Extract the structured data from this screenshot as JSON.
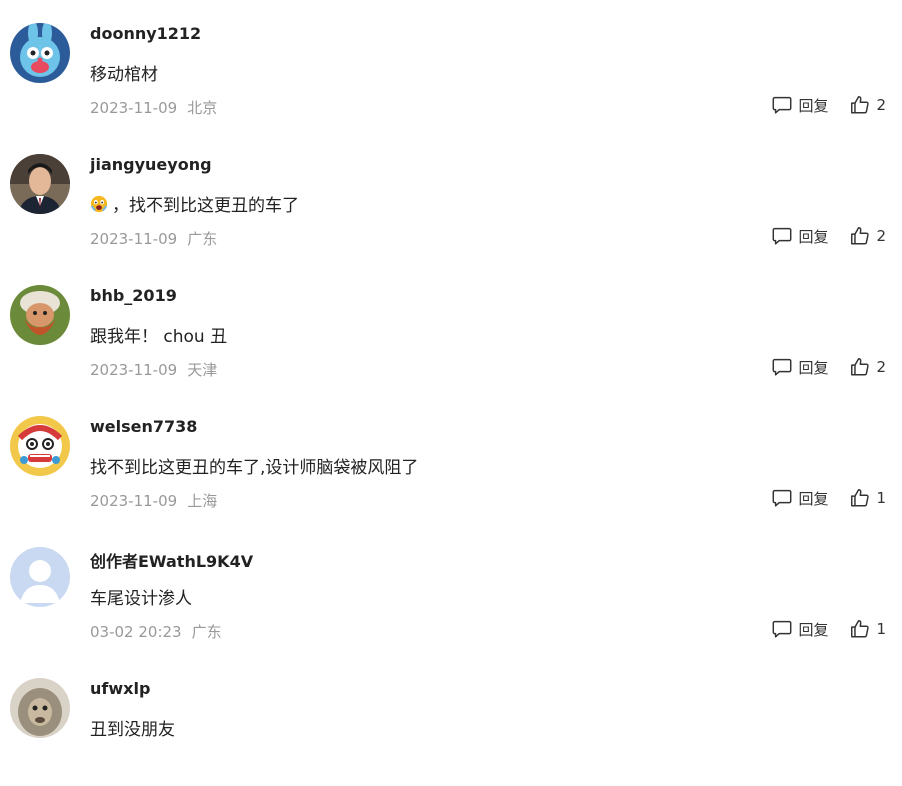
{
  "comments": [
    {
      "user": "doonny1212",
      "text": "移动棺材",
      "emoji": "",
      "time": "2023-11-09",
      "location": "北京",
      "reply_label": "回复",
      "likes": "2",
      "avatar_icon": "blue-rabbit-avatar",
      "avatar_color": "#2c5b9a"
    },
    {
      "user": "jiangyueyong",
      "text": "，找不到比这更丑的车了",
      "emoji": "scared-face-emoji",
      "time": "2023-11-09",
      "location": "广东",
      "reply_label": "回复",
      "likes": "2",
      "avatar_icon": "man-in-suit-avatar",
      "avatar_color": "#4a4038"
    },
    {
      "user": "bhb_2019",
      "text": "跟我年！ chou 丑",
      "emoji": "",
      "time": "2023-11-09",
      "location": "天津",
      "reply_label": "回复",
      "likes": "2",
      "avatar_icon": "bearded-dwarf-avatar",
      "avatar_color": "#6b8a3a"
    },
    {
      "user": "welsen7738",
      "text": "找不到比这更丑的车了,设计师脑袋被风阻了",
      "emoji": "",
      "time": "2023-11-09",
      "location": "上海",
      "reply_label": "回复",
      "likes": "1",
      "avatar_icon": "lion-dance-avatar",
      "avatar_color": "#f2c84b"
    },
    {
      "user": "创作者EWathL9K4V",
      "text": "车尾设计渗人",
      "emoji": "",
      "time": "03-02 20:23",
      "location": "广东",
      "reply_label": "回复",
      "likes": "1",
      "avatar_icon": "default-user-avatar",
      "avatar_color": "#c9d9f2"
    },
    {
      "user": "ufwxlp",
      "text": "丑到没朋友",
      "emoji": "",
      "time": "",
      "location": "",
      "reply_label": "",
      "likes": "",
      "avatar_icon": "monkey-avatar",
      "avatar_color": "#9a8e7c"
    }
  ],
  "colors": {
    "meta_text": "#999999",
    "body_text": "#222222",
    "icon_stroke": "#333333"
  }
}
